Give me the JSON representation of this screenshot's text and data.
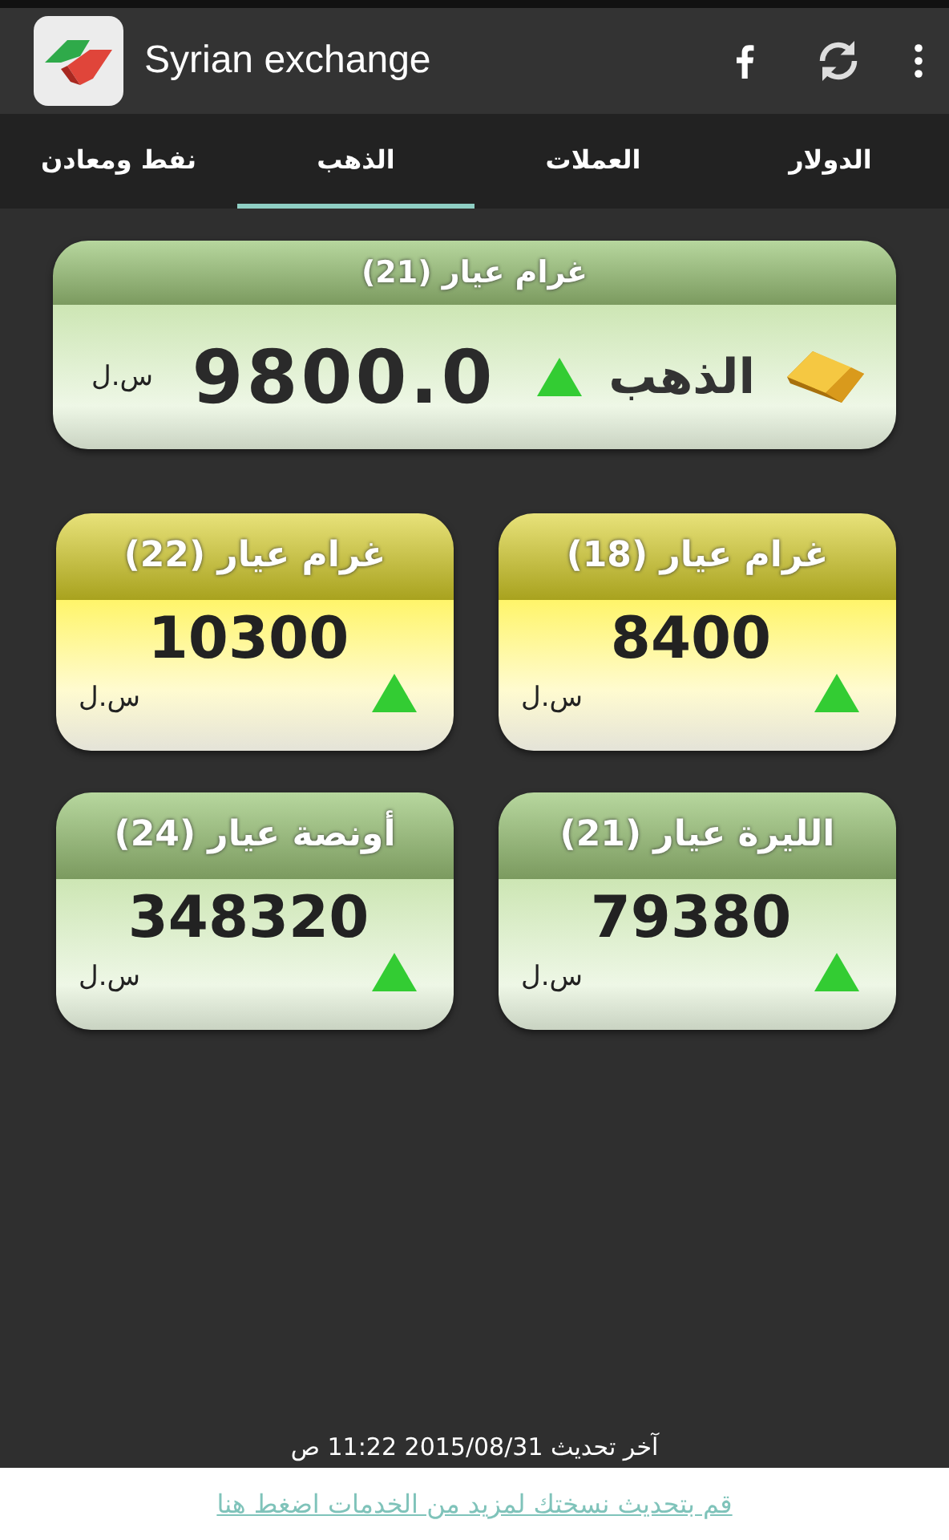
{
  "app_bar": {
    "title": "Syrian exchange"
  },
  "tabs": [
    {
      "label": "الدولار",
      "selected": false
    },
    {
      "label": "العملات",
      "selected": false
    },
    {
      "label": "الذهب",
      "selected": true
    },
    {
      "label": "نفط ومعادن",
      "selected": false
    }
  ],
  "main_card": {
    "header": "غرام عيار (21)",
    "name": "الذهب",
    "rising": true,
    "price": "9800.0",
    "currency": "ل.س"
  },
  "cards": [
    {
      "kind": "yellow",
      "header": "غرام عيار (18)",
      "price": "8400",
      "currency": "ل.س",
      "rising": true
    },
    {
      "kind": "yellow",
      "header": "غرام عيار (22)",
      "price": "10300",
      "currency": "ل.س",
      "rising": true
    },
    {
      "kind": "green",
      "header": "الليرة عيار (21)",
      "price": "79380",
      "currency": "ل.س",
      "rising": true
    },
    {
      "kind": "green",
      "header": "أونصة عيار (24)",
      "price": "348320",
      "currency": "ل.س",
      "rising": true
    }
  ],
  "last_update": "آخر تحديث 2015/08/31 11:22 ص",
  "update_link": "قم بتحديث نسختك لمزيد من الخدمات اضغط هنا"
}
